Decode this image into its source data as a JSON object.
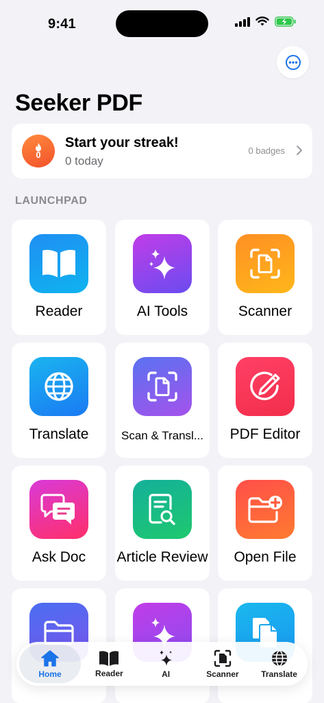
{
  "status_bar": {
    "time": "9:41"
  },
  "header": {
    "title": "Seeker PDF",
    "more_icon": "ellipsis-circle-icon"
  },
  "streak": {
    "title": "Start your streak!",
    "subtitle": "0 today",
    "badges": "0 badges",
    "icon_count": "0"
  },
  "launchpad": {
    "label": "LAUNCHPAD",
    "tiles": [
      {
        "label": "Reader",
        "icon": "book-icon"
      },
      {
        "label": "AI Tools",
        "icon": "sparkles-icon"
      },
      {
        "label": "Scanner",
        "icon": "doc-scan-icon"
      },
      {
        "label": "Translate",
        "icon": "globe-icon"
      },
      {
        "label": "Scan & Transl...",
        "icon": "doc-scan-icon"
      },
      {
        "label": "PDF Editor",
        "icon": "pencil-circle-icon"
      },
      {
        "label": "Ask Doc",
        "icon": "chat-bubbles-icon"
      },
      {
        "label": "Article Review",
        "icon": "doc-search-icon"
      },
      {
        "label": "Open File",
        "icon": "folder-plus-icon"
      },
      {
        "label": "",
        "icon": "folder-icon"
      },
      {
        "label": "",
        "icon": "sparkles-icon"
      },
      {
        "label": "",
        "icon": "docs-icon"
      }
    ]
  },
  "tab_bar": {
    "tabs": [
      {
        "label": "Home",
        "icon": "house-icon",
        "active": true
      },
      {
        "label": "Reader",
        "icon": "book-icon"
      },
      {
        "label": "AI",
        "icon": "sparkles-icon"
      },
      {
        "label": "Scanner",
        "icon": "doc-scan-icon"
      },
      {
        "label": "Translate",
        "icon": "globe-icon"
      }
    ]
  },
  "colors": {
    "background": "#f2f2f7",
    "accent": "#1a73e8",
    "reader": "#1a8cf0",
    "ai_tools": "#b23fe6",
    "scanner": "#ff9a1a",
    "translate": "#1aa3f2",
    "scan_translate": "#8a5cf0",
    "pdf_editor": "#fa3c58",
    "ask_doc": "#f0307a",
    "article_review": "#17b8a0",
    "open_file": "#fb6040"
  }
}
